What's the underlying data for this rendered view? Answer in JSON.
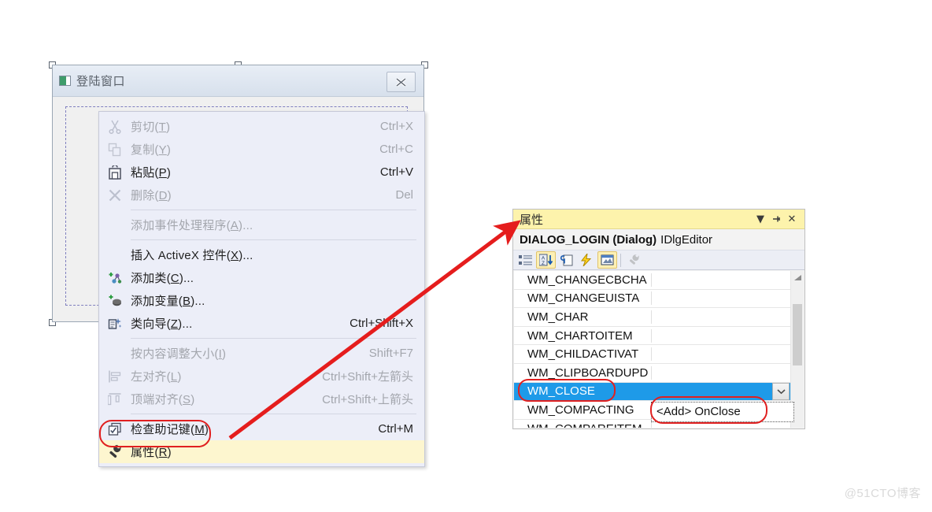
{
  "dialog_window": {
    "title": "登陆窗口",
    "app_icon": "app-window-icon",
    "close_label": "✖"
  },
  "context_menu": {
    "items": [
      {
        "icon": "cut-icon",
        "label": "剪切(T)",
        "accel": "Ctrl+X",
        "disabled": true,
        "sep_after": false
      },
      {
        "icon": "copy-icon",
        "label": "复制(Y)",
        "accel": "Ctrl+C",
        "disabled": true,
        "sep_after": false
      },
      {
        "icon": "paste-icon",
        "label": "粘贴(P)",
        "accel": "Ctrl+V",
        "disabled": false,
        "sep_after": false
      },
      {
        "icon": "delete-icon",
        "label": "删除(D)",
        "accel": "Del",
        "disabled": true,
        "sep_after": true
      },
      {
        "icon": "none",
        "label": "添加事件处理程序(A)...",
        "accel": "",
        "disabled": true,
        "sep_after": true
      },
      {
        "icon": "none",
        "label": "插入 ActiveX 控件(X)...",
        "accel": "",
        "disabled": false,
        "sep_after": false
      },
      {
        "icon": "add-class-icon",
        "label": "添加类(C)...",
        "accel": "",
        "disabled": false,
        "sep_after": false
      },
      {
        "icon": "add-variable-icon",
        "label": "添加变量(B)...",
        "accel": "",
        "disabled": false,
        "sep_after": false
      },
      {
        "icon": "class-wizard-icon",
        "label": "类向导(Z)...",
        "accel": "Ctrl+Shift+X",
        "disabled": false,
        "sep_after": true
      },
      {
        "icon": "none",
        "label": "按内容调整大小(I)",
        "accel": "Shift+F7",
        "disabled": true,
        "sep_after": false
      },
      {
        "icon": "align-left-icon",
        "label": "左对齐(L)",
        "accel": "Ctrl+Shift+左箭头",
        "disabled": true,
        "sep_after": false
      },
      {
        "icon": "align-top-icon",
        "label": "顶端对齐(S)",
        "accel": "Ctrl+Shift+上箭头",
        "disabled": true,
        "sep_after": true
      },
      {
        "icon": "check-mnemonic-icon",
        "label": "检查助记键(M)",
        "accel": "Ctrl+M",
        "disabled": false,
        "sep_after": false
      },
      {
        "icon": "wrench-icon",
        "label": "属性(R)",
        "accel": "",
        "disabled": false,
        "highlighted": true,
        "sep_after": false
      }
    ],
    "highlight_color": "#fdf6cf"
  },
  "properties_panel": {
    "title": "属性",
    "title_bar_color": "#fdf3ac",
    "dropdown_label": "▼",
    "pin_label": "⊣",
    "close_label": "✕",
    "object_name": "DIALOG_LOGIN (Dialog)",
    "object_type": "IDlgEditor",
    "toolbar": [
      {
        "name": "categorized-view-icon",
        "active": false
      },
      {
        "name": "alphabetical-sort-icon",
        "active": true
      },
      {
        "name": "properties-page-icon",
        "active": false
      },
      {
        "name": "events-icon",
        "active": false
      },
      {
        "name": "messages-icon",
        "active": true
      },
      {
        "name": "property-pages-wrench-icon",
        "active": false,
        "disabled": true
      }
    ],
    "rows": [
      {
        "name": "WM_CHANGECBCHA",
        "value": "",
        "selected": false
      },
      {
        "name": "WM_CHANGEUISTA",
        "value": "",
        "selected": false
      },
      {
        "name": "WM_CHAR",
        "value": "",
        "selected": false
      },
      {
        "name": "WM_CHARTOITEM",
        "value": "",
        "selected": false
      },
      {
        "name": "WM_CHILDACTIVAT",
        "value": "",
        "selected": false
      },
      {
        "name": "WM_CLIPBOARDUPD",
        "value": "",
        "selected": false
      },
      {
        "name": "WM_CLOSE",
        "value": "",
        "selected": true
      },
      {
        "name": "WM_COMPACTING",
        "value": "",
        "selected": false
      },
      {
        "name": "WM_COMPAREITEM",
        "value": "",
        "selected": false
      }
    ],
    "selection_color": "#1e9ae8",
    "dropdown_arrow": "⌄",
    "tooltip_value": "<Add> OnClose",
    "scrollbar_up_arrow": "▲"
  },
  "annotations": {
    "color": "#e02020",
    "arrow_from": "属性(R)",
    "arrow_to": "属性"
  },
  "watermark": "@51CTO博客"
}
